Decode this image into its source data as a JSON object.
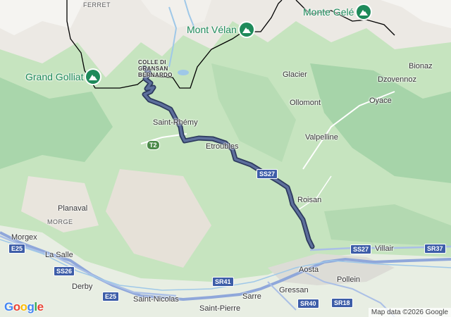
{
  "colors": {
    "route": "#4a5b86",
    "route_outline": "#2d3a5e",
    "road": "#8fa7da",
    "shield_blue": "#3d5da8",
    "shield_green": "#4c8a4a",
    "peak": "#1e8a5a",
    "border": "#000000"
  },
  "peaks": [
    {
      "name": "Grand Golliat",
      "icon": "mountain-icon"
    },
    {
      "name": "Mont Vélan",
      "icon": "mountain-icon"
    },
    {
      "name": "Monte Gelé",
      "icon": "mountain-icon"
    }
  ],
  "pass": {
    "line1": "COLLE DI",
    "line2": "GRAN SAN",
    "line3": "BERNARDO",
    "line2a": "GRAN",
    "line2b": "SAN"
  },
  "places": {
    "ferret": "FERRET",
    "glacier": "Glacier",
    "bionaz": "Bionaz",
    "dzovennoz": "Dzovennoz",
    "ollomont": "Ollomont",
    "oyace": "Oyace",
    "saint_rhemy": "Saint-Rhémy",
    "etroubles": "Etroubles",
    "valpelline": "Valpelline",
    "roisan": "Roisan",
    "planaval": "Planaval",
    "morge": "MORGE",
    "morgex": "Morgex",
    "la_salle": "La Salle",
    "villair": "Villair",
    "aosta": "Aosta",
    "pollein": "Pollein",
    "derby": "Derby",
    "sarre": "Sarre",
    "gressan": "Gressan",
    "saint_nicolas": "Saint-Nicolas",
    "saint_pierre": "Saint-Pierre"
  },
  "shields": {
    "t2": "T2",
    "ss27a": "SS27",
    "ss27b": "SS27",
    "sr37": "SR37",
    "e25a": "E25",
    "ss26": "SS26",
    "e25b": "E25",
    "sr41": "SR41",
    "sr40": "SR40",
    "sr18": "SR18"
  },
  "branding": {
    "logo": "Google",
    "attribution": "Map data ©2026 Google"
  }
}
